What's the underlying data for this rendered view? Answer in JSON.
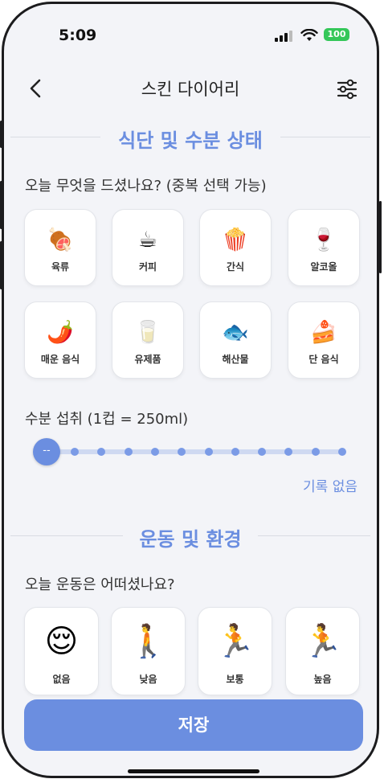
{
  "status_bar": {
    "time": "5:09",
    "battery": "100"
  },
  "header": {
    "title": "스킨 다이어리"
  },
  "diet": {
    "section_title": "식단 및 수분 상태",
    "question": "오늘 무엇을 드셨나요? (중복 선택 가능)",
    "items": [
      {
        "icon": "meat-icon",
        "emoji": "🍖",
        "label": "육류"
      },
      {
        "icon": "coffee-icon",
        "emoji": "☕",
        "label": "커피"
      },
      {
        "icon": "popcorn-icon",
        "emoji": "🍿",
        "label": "간식"
      },
      {
        "icon": "wine-icon",
        "emoji": "🍷",
        "label": "알코올"
      },
      {
        "icon": "pepper-icon",
        "emoji": "🌶️",
        "label": "매운 음식"
      },
      {
        "icon": "milk-icon",
        "emoji": "🥛",
        "label": "유제품"
      },
      {
        "icon": "fish-icon",
        "emoji": "🐟",
        "label": "해산물"
      },
      {
        "icon": "cake-icon",
        "emoji": "🍰",
        "label": "단 음식"
      }
    ]
  },
  "water": {
    "label": "수분 섭취  (1컵 = 250ml)",
    "knob_text": "--",
    "level": 0,
    "steps": 11,
    "status": "기록 없음"
  },
  "exercise": {
    "section_title": "운동 및 환경",
    "question": "오늘 운동은 어떠셨나요?",
    "items": [
      {
        "icon": "resting-person-icon",
        "emoji": "😌",
        "label": "없음"
      },
      {
        "icon": "walking-person-icon",
        "emoji": "🚶",
        "label": "낮음"
      },
      {
        "icon": "running-person-icon",
        "emoji": "🏃",
        "label": "보통"
      },
      {
        "icon": "sprinting-person-icon",
        "emoji": "🏃",
        "label": "높음"
      }
    ]
  },
  "footer": {
    "save_label": "저장"
  },
  "colors": {
    "accent": "#6b8ee0",
    "background": "#f3f4f8"
  }
}
